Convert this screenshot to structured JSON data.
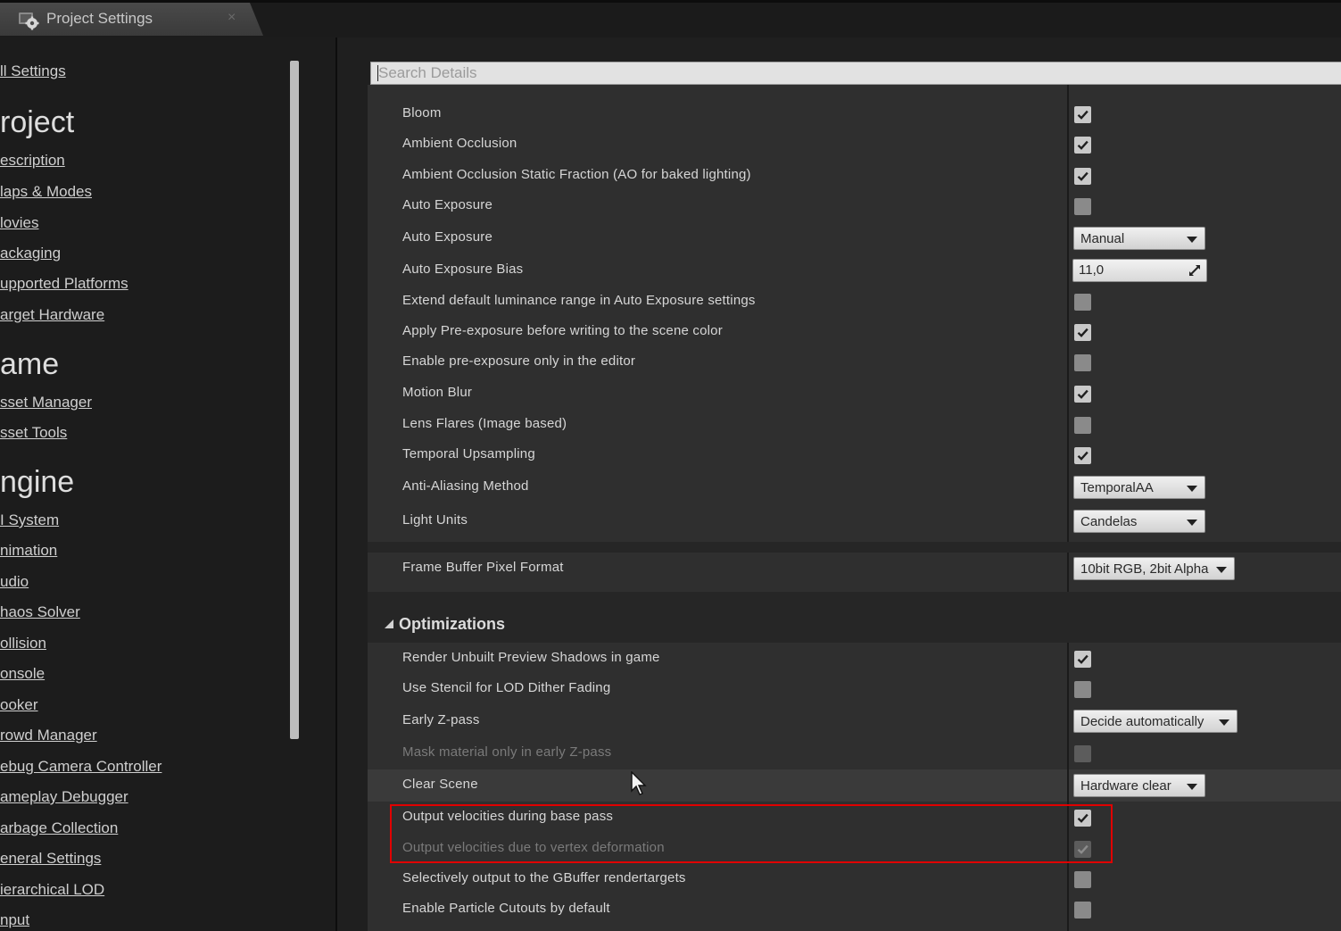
{
  "window": {
    "tab_title": "Project Settings",
    "tab_close": "×"
  },
  "sidebar": {
    "items": [
      {
        "label": "ll Settings",
        "kind": "link"
      },
      {
        "label": "roject",
        "kind": "header"
      },
      {
        "label": "escription",
        "kind": "link"
      },
      {
        "label": "laps & Modes",
        "kind": "link"
      },
      {
        "label": "lovies",
        "kind": "link"
      },
      {
        "label": "ackaging",
        "kind": "link"
      },
      {
        "label": "upported Platforms",
        "kind": "link"
      },
      {
        "label": "arget Hardware",
        "kind": "link"
      },
      {
        "label": "ame",
        "kind": "header"
      },
      {
        "label": "sset Manager",
        "kind": "link"
      },
      {
        "label": "sset Tools",
        "kind": "link"
      },
      {
        "label": "ngine",
        "kind": "header"
      },
      {
        "label": "I System",
        "kind": "link"
      },
      {
        "label": "nimation",
        "kind": "link"
      },
      {
        "label": "udio",
        "kind": "link"
      },
      {
        "label": "haos Solver",
        "kind": "link"
      },
      {
        "label": "ollision",
        "kind": "link"
      },
      {
        "label": "onsole",
        "kind": "link"
      },
      {
        "label": "ooker",
        "kind": "link"
      },
      {
        "label": "rowd Manager",
        "kind": "link"
      },
      {
        "label": "ebug Camera Controller",
        "kind": "link"
      },
      {
        "label": "ameplay Debugger",
        "kind": "link"
      },
      {
        "label": "arbage Collection",
        "kind": "link"
      },
      {
        "label": "eneral Settings",
        "kind": "link"
      },
      {
        "label": "ierarchical LOD",
        "kind": "link"
      },
      {
        "label": "nput",
        "kind": "link"
      }
    ]
  },
  "search": {
    "placeholder": "Search Details"
  },
  "rows": [
    {
      "label": "Bloom",
      "control": "checkbox",
      "checked": true
    },
    {
      "label": "Ambient Occlusion",
      "control": "checkbox",
      "checked": true
    },
    {
      "label": "Ambient Occlusion Static Fraction (AO for baked lighting)",
      "control": "checkbox",
      "checked": true
    },
    {
      "label": "Auto Exposure",
      "control": "checkbox",
      "checked": false
    },
    {
      "label": "Auto Exposure",
      "control": "dropdown",
      "value": "Manual"
    },
    {
      "label": "Auto Exposure Bias",
      "control": "number",
      "value": "11,0"
    },
    {
      "label": "Extend default luminance range in Auto Exposure settings",
      "control": "checkbox",
      "checked": false
    },
    {
      "label": "Apply Pre-exposure before writing to the scene color",
      "control": "checkbox",
      "checked": true
    },
    {
      "label": "Enable pre-exposure only in the editor",
      "control": "checkbox",
      "checked": false
    },
    {
      "label": "Motion Blur",
      "control": "checkbox",
      "checked": true
    },
    {
      "label": "Lens Flares (Image based)",
      "control": "checkbox",
      "checked": false
    },
    {
      "label": "Temporal Upsampling",
      "control": "checkbox",
      "checked": true
    },
    {
      "label": "Anti-Aliasing Method",
      "control": "dropdown",
      "value": "TemporalAA"
    },
    {
      "label": "Light Units",
      "control": "dropdown",
      "value": "Candelas"
    },
    {
      "label": "Frame Buffer Pixel Format",
      "control": "dropdown",
      "value": "10bit RGB, 2bit Alpha"
    }
  ],
  "optimizations": {
    "title": "Optimizations",
    "rows": [
      {
        "label": "Render Unbuilt Preview Shadows in game",
        "control": "checkbox",
        "checked": true
      },
      {
        "label": "Use Stencil for LOD Dither Fading",
        "control": "checkbox",
        "checked": false
      },
      {
        "label": "Early Z-pass",
        "control": "dropdown",
        "value": "Decide automatically"
      },
      {
        "label": "Mask material only in early Z-pass",
        "control": "checkbox",
        "checked": false,
        "disabled": true
      },
      {
        "label": "Clear Scene",
        "control": "dropdown",
        "value": "Hardware clear"
      },
      {
        "label": "Output velocities during base pass",
        "control": "checkbox",
        "checked": true
      },
      {
        "label": "Output velocities due to vertex deformation",
        "control": "checkbox",
        "checked": true,
        "disabled": true
      },
      {
        "label": "Selectively output to the GBuffer rendertargets",
        "control": "checkbox",
        "checked": false
      },
      {
        "label": "Enable Particle Cutouts by default",
        "control": "checkbox",
        "checked": false
      }
    ]
  },
  "colors": {
    "highlight_box": "#e00000",
    "checkbox_on": "#c9c9c9",
    "panel_bg": "#2f2f2f"
  }
}
